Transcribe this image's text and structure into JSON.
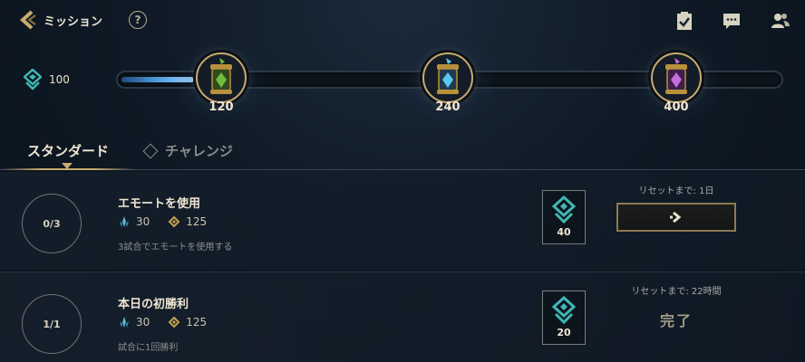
{
  "header": {
    "title": "ミッション",
    "help_label": "?"
  },
  "currency": {
    "value": "100"
  },
  "track": {
    "progress_fraction": 0.11,
    "milestones": [
      {
        "value": "120",
        "orb_color": "#6fbf3a"
      },
      {
        "value": "240",
        "orb_color": "#5ac8f0"
      },
      {
        "value": "400",
        "orb_color": "#c86ae0"
      }
    ]
  },
  "tabs": [
    {
      "label": "スタンダード",
      "active": true
    },
    {
      "label": "チャレンジ",
      "active": false
    }
  ],
  "missions": [
    {
      "progress": "0/3",
      "title": "エモートを使用",
      "reward_blue": "30",
      "reward_gold": "125",
      "description": "3試合でエモートを使用する",
      "tokens": "40",
      "reset": "リセットまで: 1日",
      "status": "go"
    },
    {
      "progress": "1/1",
      "title": "本日の初勝利",
      "reward_blue": "30",
      "reward_gold": "125",
      "description": "試合に1回勝利",
      "tokens": "20",
      "reset": "リセットまで: 22時間",
      "status_label": "完了"
    }
  ],
  "colors": {
    "accent_gold": "#c8aa6e",
    "accent_teal": "#3fb7b4",
    "background": "#0f1a26"
  }
}
